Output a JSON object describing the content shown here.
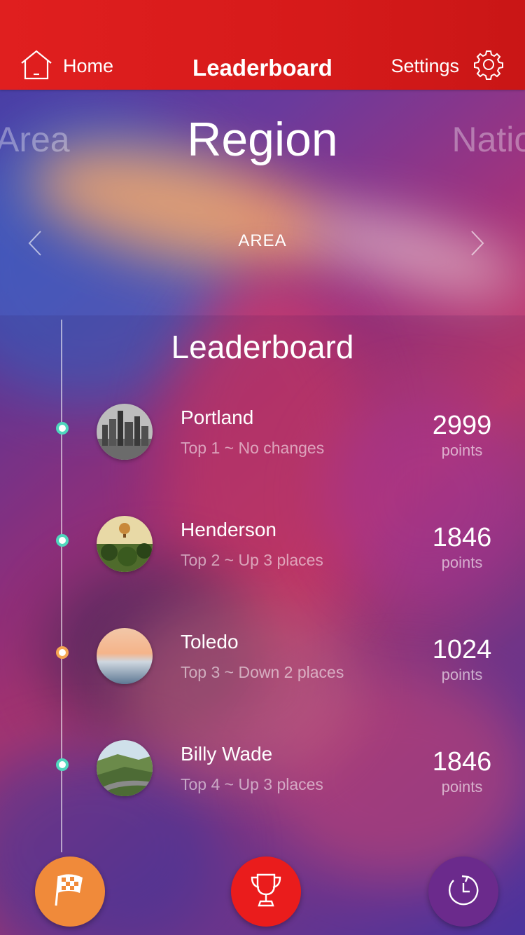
{
  "header": {
    "home_label": "Home",
    "title": "Leaderboard",
    "settings_label": "Settings"
  },
  "region_tabs": {
    "previous": "Area",
    "current": "Region",
    "next": "Nation",
    "sub_label": "AREA"
  },
  "leaderboard": {
    "title": "Leaderboard",
    "entries": [
      {
        "name": "Portland",
        "status": "Top 1 ~ No changes",
        "score": "2999",
        "unit": "points",
        "marker": "teal"
      },
      {
        "name": "Henderson",
        "status": "Top 2 ~ Up 3 places",
        "score": "1846",
        "unit": "points",
        "marker": "teal"
      },
      {
        "name": "Toledo",
        "status": "Top 3 ~ Down 2 places",
        "score": "1024",
        "unit": "points",
        "marker": "orange"
      },
      {
        "name": "Billy Wade",
        "status": "Top 4 ~ Up 3 places",
        "score": "1846",
        "unit": "points",
        "marker": "teal"
      }
    ]
  },
  "bottom_nav": {
    "items": [
      "flag-icon",
      "trophy-icon",
      "timer-icon"
    ]
  },
  "colors": {
    "header": "#e01f1f",
    "marker_teal": "#4fd6bd",
    "marker_orange": "#f5a552",
    "fab_flag": "#f08a3a",
    "fab_trophy": "#ea1c1c",
    "fab_timer": "#6b2a8c"
  }
}
